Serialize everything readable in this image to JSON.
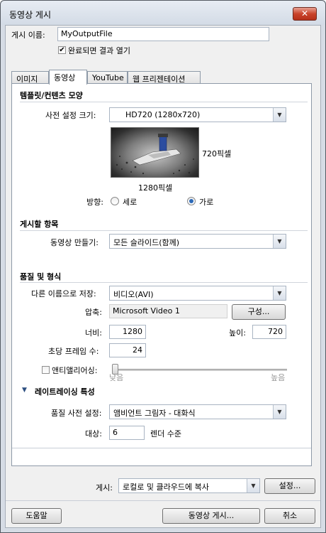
{
  "window": {
    "title": "동영상 게시",
    "close_glyph": "✕"
  },
  "publish_name": {
    "label": "게시 이름:",
    "value": "MyOutputFile"
  },
  "open_when_done": {
    "label": "완료되면 결과 열기",
    "checked": true
  },
  "tabs": [
    {
      "label": "이미지",
      "active": false
    },
    {
      "label": "동영상",
      "active": true
    },
    {
      "label": "YouTube",
      "active": false
    },
    {
      "label": "웹 프리젠테이션",
      "active": false
    }
  ],
  "template": {
    "title": "템플릿/컨텐츠 모양",
    "preset_label": "사전 설정 크기:",
    "preset_value": "HD720 (1280x720)",
    "height_caption": "720픽셀",
    "width_caption": "1280픽셀",
    "orientation_label": "방향:",
    "portrait_label": "세로",
    "landscape_label": "가로",
    "orientation_selected": "가로"
  },
  "publish_items": {
    "title": "게시할 항목",
    "make_movie_label": "동영상 만들기:",
    "make_movie_value": "모든 슬라이드(함께)"
  },
  "quality": {
    "title": "품질 및 형식",
    "save_as_label": "다른 이름으로 저장:",
    "save_as_value": "비디오(AVI)",
    "compression_label": "압축:",
    "compression_value": "Microsoft Video 1",
    "configure_button": "구성...",
    "width_label": "너비:",
    "width_value": "1280",
    "height_label": "높이:",
    "height_value": "720",
    "fps_label": "초당 프레임 수:",
    "fps_value": "24",
    "antialias_label": "앤티앨리어싱:",
    "antialias_checked": false,
    "antialias_low": "낮음",
    "antialias_high": "높음",
    "antialias_level": 0.0
  },
  "raytracing": {
    "title": "레이트레이싱 특성",
    "expanded": true,
    "preset_label": "품질 사전 설정:",
    "preset_value": "앰비언트 그림자 - 대화식",
    "target_label": "대상:",
    "target_value": "6",
    "target_unit": "렌더 수준"
  },
  "footer": {
    "publish_label": "게시:",
    "publish_value": "로컬로 및 클라우드에 복사",
    "settings_button": "설정...",
    "help_button": "도움말",
    "publish_movie_button": "동영상 게시...",
    "cancel_button": "취소"
  },
  "icons": {
    "dropdown": "chevron-down-icon",
    "collapse": "triangle-down-icon",
    "check": "checkmark-icon"
  }
}
